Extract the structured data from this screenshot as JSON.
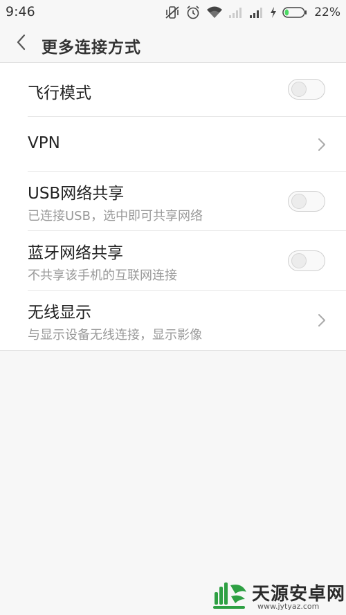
{
  "status_bar": {
    "time": "9:46",
    "battery_percent": "22%",
    "battery_level": 0.22,
    "icons": [
      "vibrate-mute-icon",
      "alarm-icon",
      "wifi-icon",
      "signal-sim1-icon",
      "signal-sim2-icon",
      "charging-icon",
      "battery-icon"
    ]
  },
  "header": {
    "back_icon": "chevron-left-icon",
    "title": "更多连接方式"
  },
  "settings": [
    {
      "title": "飞行模式",
      "subtitle": "",
      "control": "toggle",
      "on": false
    },
    {
      "title": "VPN",
      "subtitle": "",
      "control": "chevron"
    },
    {
      "title": "USB网络共享",
      "subtitle": "已连接USB，选中即可共享网络",
      "control": "toggle",
      "on": false
    },
    {
      "title": "蓝牙网络共享",
      "subtitle": "不共享该手机的互联网连接",
      "control": "toggle",
      "on": false
    },
    {
      "title": "无线显示",
      "subtitle": "与显示设备无线连接，显示影像",
      "control": "chevron"
    }
  ],
  "watermark": {
    "title": "天源安卓网",
    "url": "www.jytyaz.com"
  },
  "colors": {
    "background": "#f7f7f7",
    "list_background": "#ffffff",
    "battery_green": "#4cd964",
    "text_primary": "#222222",
    "text_secondary": "#999999",
    "watermark_green": "#2ea043"
  }
}
